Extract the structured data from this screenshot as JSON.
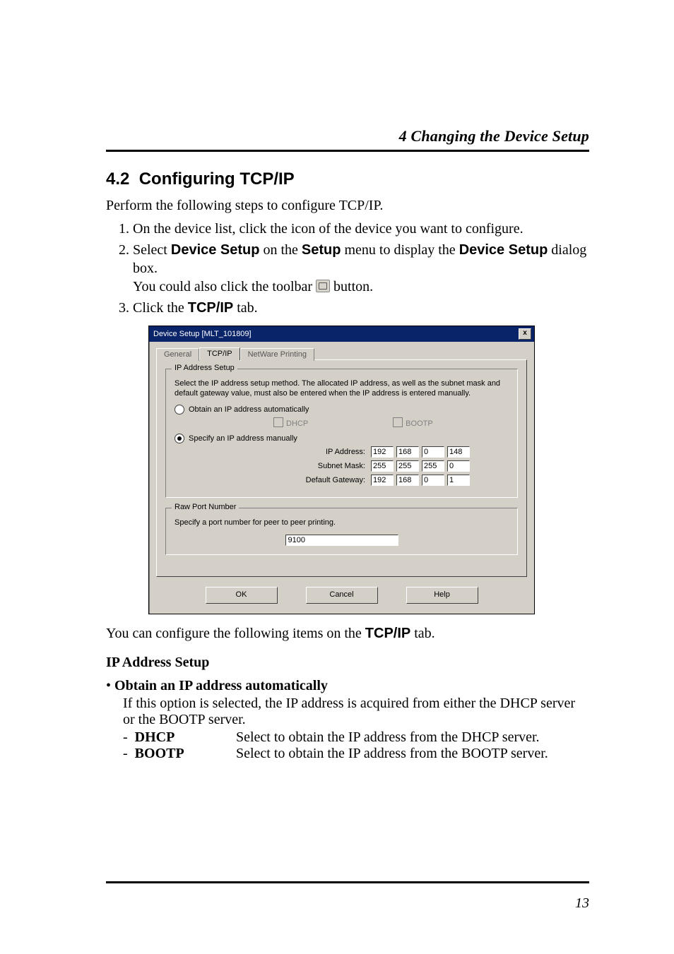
{
  "header": {
    "running": "4  Changing the Device Setup"
  },
  "section": {
    "number": "4.2",
    "title": "Configuring TCP/IP",
    "intro": "Perform the following steps to configure TCP/IP.",
    "steps": {
      "s1": "On the device list, click the icon of the device you want to configure.",
      "s2a": "Select ",
      "s2_devsetup": "Device Setup",
      "s2b": " on the ",
      "s2_setup": "Setup",
      "s2c": " menu to display the ",
      "s2_devsetup2": "Device Setup",
      "s2d": " dialog box.",
      "s2_note_a": "You could also click the toolbar ",
      "s2_note_b": " button.",
      "s3a": "Click the ",
      "s3_tcp": "TCP/IP",
      "s3b": " tab."
    }
  },
  "dialog": {
    "title": "Device Setup [MLT_101809]",
    "close": "x",
    "tabs": {
      "general": "General",
      "tcpip": "TCP/IP",
      "netware": "NetWare Printing"
    },
    "ip_setup": {
      "legend": "IP Address Setup",
      "desc": "Select the IP address setup method. The allocated IP address, as well as the subnet mask and default gateway value, must also be entered when the IP address is entered manually.",
      "auto_label": "Obtain an IP address automatically",
      "dhcp_label": "DHCP",
      "bootp_label": "BOOTP",
      "manual_label": "Specify an IP address manually",
      "ip_label": "IP Address:",
      "mask_label": "Subnet Mask:",
      "gw_label": "Default Gateway:",
      "ip": [
        "192",
        "168",
        "0",
        "148"
      ],
      "mask": [
        "255",
        "255",
        "255",
        "0"
      ],
      "gw": [
        "192",
        "168",
        "0",
        "1"
      ]
    },
    "raw_port": {
      "legend": "Raw Port Number",
      "desc": "Specify a port number for peer to peer printing.",
      "value": "9100"
    },
    "buttons": {
      "ok": "OK",
      "cancel": "Cancel",
      "help": "Help"
    }
  },
  "after": {
    "note_a": "You can configure the following items on the ",
    "note_tcp": "TCP/IP",
    "note_b": " tab.",
    "subhead": "IP Address Setup",
    "bullet_title": "Obtain an IP address automatically",
    "bullet_body": "If this option is selected, the IP address is acquired from either the DHCP server or the BOOTP server.",
    "defs": {
      "dhcp_term": "DHCP",
      "dhcp_desc": "Select to obtain the IP address from the DHCP server.",
      "bootp_term": "BOOTP",
      "bootp_desc": "Select to obtain the IP address from the BOOTP server."
    }
  },
  "pagenum": "13"
}
